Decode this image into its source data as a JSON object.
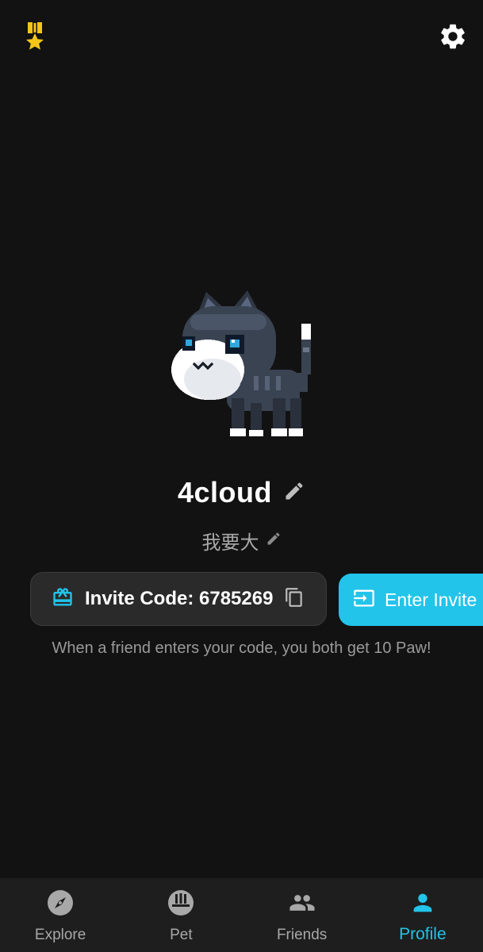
{
  "colors": {
    "background": "#121212",
    "accent": "#22c4ea",
    "medal": "#f5c518",
    "nav_background": "#1e1e1e",
    "muted_text": "#a8a8a8"
  },
  "header": {
    "left_icon": "medal-icon",
    "right_icon": "settings-gear-icon"
  },
  "profile": {
    "username": "4cloud",
    "bio": "我要大",
    "pet_image": "pixel-cat"
  },
  "invite": {
    "code_label": "Invite Code: 6785269",
    "enter_label": "Enter Invite",
    "hint": "When a friend enters your code, you both get 10 Paw!"
  },
  "nav": {
    "active": "Profile",
    "items": [
      {
        "label": "Explore",
        "icon": "compass-icon"
      },
      {
        "label": "Pet",
        "icon": "pet-icon"
      },
      {
        "label": "Friends",
        "icon": "friends-icon"
      },
      {
        "label": "Profile",
        "icon": "person-icon"
      }
    ]
  }
}
